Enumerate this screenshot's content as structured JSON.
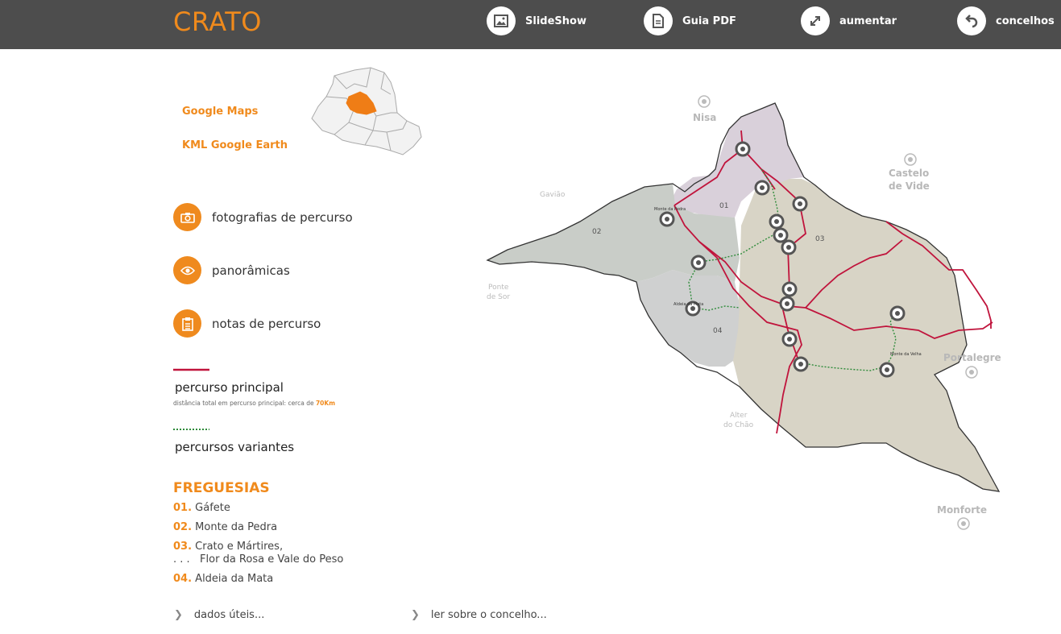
{
  "header": {
    "brand": "CRATO",
    "nav": [
      {
        "label": "SlideShow",
        "icon": "image-icon"
      },
      {
        "label": "Guia PDF",
        "icon": "document-icon"
      },
      {
        "label": "aumentar",
        "icon": "expand-icon"
      },
      {
        "label": "concelhos",
        "icon": "back-arrow-icon"
      }
    ]
  },
  "links": {
    "google_maps": "Google Maps",
    "kml": "KML Google Earth"
  },
  "features": [
    {
      "label": "fotografias de percurso",
      "icon": "camera-icon"
    },
    {
      "label": "panorâmicas",
      "icon": "eye-icon"
    },
    {
      "label": "notas de percurso",
      "icon": "clipboard-icon"
    }
  ],
  "legend": {
    "main_label": "percurso principal",
    "main_sub_prefix": "distância total em percurso principal: cerca de ",
    "main_sub_value": "70Km",
    "main_color": "#c0143c",
    "variant_label": "percursos  variantes",
    "variant_color": "#2e8b3a"
  },
  "freguesias": {
    "title": "FREGUESIAS",
    "items": [
      {
        "num": "01.",
        "name": "Gáfete",
        "cont": ""
      },
      {
        "num": "02.",
        "name": "Monte da Pedra",
        "cont": ""
      },
      {
        "num": "03.",
        "name": "Crato e Mártires,",
        "cont": ". . .   Flor da Rosa e Vale do Peso"
      },
      {
        "num": "04.",
        "name": "Aldeia da Mata",
        "cont": ""
      }
    ]
  },
  "footer": {
    "dados": "dados úteis...",
    "ler": "ler sobre o concelho..."
  },
  "map": {
    "places": {
      "nisa": "Nisa",
      "castelo1": "Castelo",
      "castelo2": "de Vide",
      "gaviao": "Gavião",
      "ponte1": "Ponte",
      "ponte2": "de Sor",
      "portalegre": "Portalegre",
      "alter1": "Alter",
      "alter2": "do Chão",
      "monforte": "Monforte"
    },
    "zones": {
      "z01": "01",
      "z02": "02",
      "z03": "03",
      "z04": "04"
    },
    "localities": {
      "monte_pedra": "Monte da Pedra",
      "aldeia_mata": "Aldeia da Mata",
      "monte_velha": "Monte da Velha"
    },
    "colors": {
      "accent": "#f08a1c",
      "zone01": "#d9d0da",
      "zone02": "#c9cdc8",
      "zone03": "#d8d4c6",
      "zone04": "#cfd0d0"
    }
  }
}
